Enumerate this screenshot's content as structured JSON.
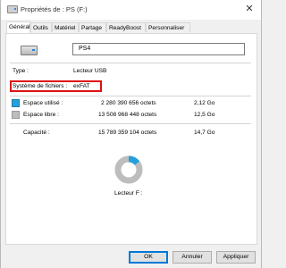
{
  "window": {
    "title": "Propriétés de : PS (F:)",
    "close_glyph": "✕"
  },
  "tabs": [
    {
      "label": "Général",
      "active": true
    },
    {
      "label": "Outils"
    },
    {
      "label": "Matériel"
    },
    {
      "label": "Partage"
    },
    {
      "label": "ReadyBoost"
    },
    {
      "label": "Personnaliser"
    }
  ],
  "general": {
    "name_value": "PS4",
    "type_label": "Type :",
    "type_value": "Lecteur USB",
    "fs_label": "Système de fichiers :",
    "fs_value": "exFAT",
    "used": {
      "label": "Espace utilisé :",
      "bytes": "2 280 390 656 octets",
      "size": "2,12 Go",
      "color": "#26a0da"
    },
    "free": {
      "label": "Espace libre :",
      "bytes": "13 508 968 448 octets",
      "size": "12,5 Go",
      "color": "#bdbdbd"
    },
    "capacity": {
      "label": "Capacité :",
      "bytes": "15 789 359 104 octets",
      "size": "14,7 Go"
    },
    "used_fraction": 0.144,
    "drive_label": "Lecteur F :",
    "highlight_color": "#e01010"
  },
  "buttons": {
    "ok": "OK",
    "cancel": "Annuler",
    "apply": "Appliquer"
  }
}
